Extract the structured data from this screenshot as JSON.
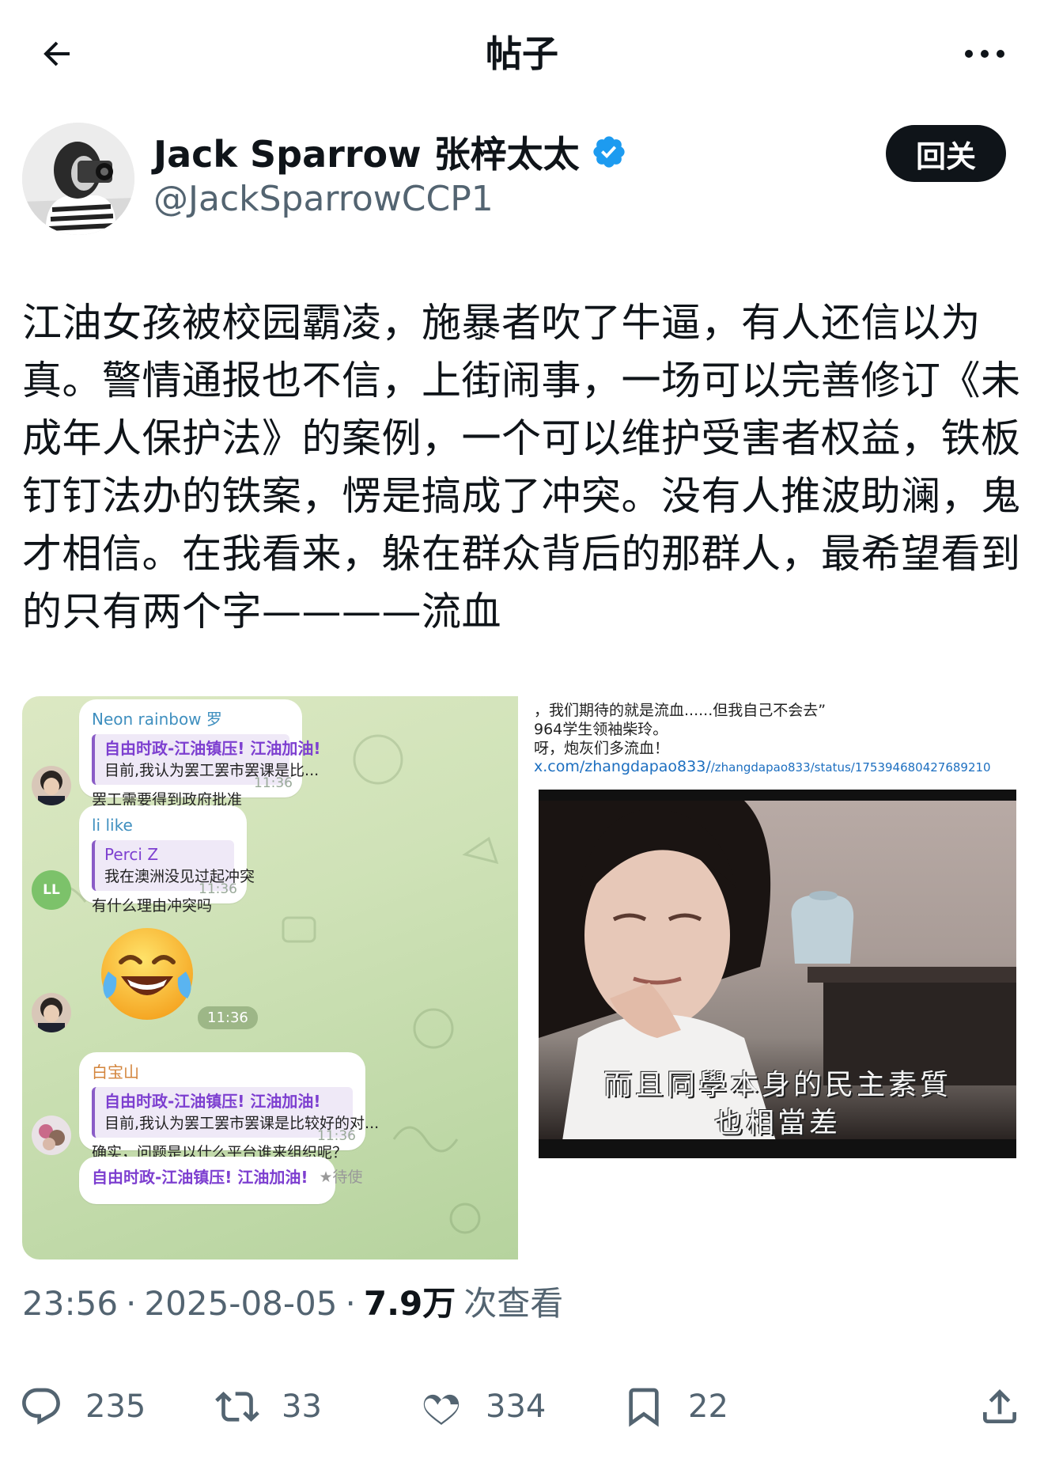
{
  "header": {
    "title": "帖子",
    "back_icon": "arrow-left-icon",
    "more_icon": "more-horizontal-icon"
  },
  "author": {
    "display_name": "Jack Sparrow 张梓太太",
    "handle": "@JackSparrowCCP1",
    "verified": true,
    "follow_label": "回关"
  },
  "post": {
    "text": "江油女孩被校园霸凌，施暴者吹了牛逼，有人还信以为真。警情通报也不信，上街闹事，一场可以完善修订《未成年人保护法》的案例，一个可以维护受害者权益，铁板钉钉法办的铁案，愣是搞成了冲突。没有人推波助澜，鬼才相信。在我看来，躲在群众背后的那群人，最希望看到的只有两个字————流血"
  },
  "media": {
    "left_image": {
      "messages": [
        {
          "sender": "Neon rainbow 罗",
          "quote_title": "自由时政-江油镇压! 江油加油!",
          "quote_text": "目前,我认为罢工罢市罢课是比...",
          "text": "罢工需要得到政府批准",
          "time": "11:36"
        },
        {
          "sender": "li like",
          "quote_title": "Perci Z",
          "quote_text": "我在澳洲没见过起冲突",
          "text": "有什么理由冲突吗",
          "time": "11:36",
          "avatar_initials": "LL"
        },
        {
          "emoji_time": "11:36"
        },
        {
          "sender": "白宝山",
          "quote_title": "自由时政-江油镇压! 江油加油!",
          "quote_text": "目前,我认为罢工罢市罢课是比较好的对...",
          "text": "确实，问题是以什么平台谁来组织呢？",
          "time": "11:36"
        },
        {
          "quote_title": "自由时政-江油镇压! 江油加油!",
          "tag": "★待使"
        }
      ]
    },
    "right_image": {
      "caption_lines": [
        "，我们期待的就是流血......但我自己不会去”",
        "964学生领袖柴玲。",
        "呀，炮灰们多流血！"
      ],
      "link_domain": "x.com/zhangdapao833/",
      "link_path": "/zhangdapao833/status/175394680427689210",
      "subtitle_lines": [
        "而且同學本身的民主素質",
        "也相當差"
      ]
    }
  },
  "meta": {
    "time": "23:56",
    "date": "2025-08-05",
    "separator": "·",
    "views_count": "7.9万",
    "views_label": "次查看"
  },
  "actions": {
    "replies": "235",
    "reposts": "33",
    "likes": "334",
    "bookmarks": "22"
  },
  "colors": {
    "accent": "#1d9bf0",
    "text_primary": "#0f1419",
    "text_secondary": "#536471"
  }
}
